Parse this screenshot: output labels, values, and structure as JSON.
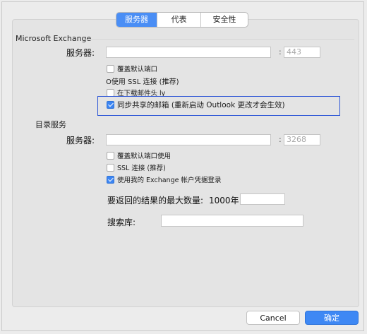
{
  "tabs": [
    "服务器",
    "代表",
    "安全性"
  ],
  "exchange": {
    "section_title": "Microsoft Exchange",
    "server_label": "服务器:",
    "server_value": "",
    "port_placeholder": "443",
    "options": [
      {
        "label": "覆盖默认端口",
        "checked": false
      },
      {
        "label": "O使用 SSL 连接 (推荐)",
        "checked": false
      },
      {
        "label": "在下载邮件头                 ly",
        "checked": false
      },
      {
        "label": "同步共享的邮箱 (重新启动 Outlook 更改才会生效)",
        "checked": true
      }
    ]
  },
  "directory": {
    "section_title": "目录服务",
    "server_label": "服务器:",
    "server_value": "",
    "port_placeholder": "3268",
    "options": [
      {
        "label": "覆盖默认端口使用",
        "checked": false
      },
      {
        "label": "SSL 连接 (推荐)",
        "checked": false
      },
      {
        "label": "使用我的 Exchange 帐户凭据登录",
        "checked": true
      }
    ],
    "max_results_label": "要返回的结果的最大数量:",
    "max_results_value": "1000年",
    "search_base_label": "搜索库:",
    "search_base_value": ""
  },
  "buttons": {
    "cancel": "Cancel",
    "ok": "确定"
  },
  "colors": {
    "accent": "#3e88f4",
    "highlight_border": "#2b54d6"
  }
}
